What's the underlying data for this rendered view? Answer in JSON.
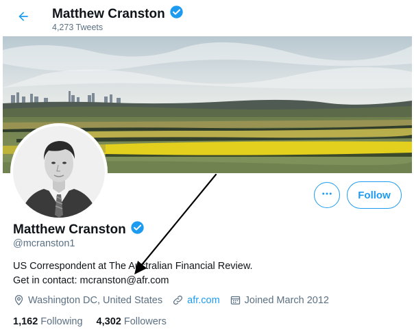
{
  "header": {
    "title": "Matthew Cranston",
    "tweet_count": "4,273 Tweets"
  },
  "profile": {
    "name": "Matthew Cranston",
    "handle": "@mcranston1",
    "bio_line1": "US Correspondent at The Australian Financial Review.",
    "bio_line2": "Get in contact: mcranston@afr.com",
    "location": "Washington DC, United States",
    "website": "afr.com",
    "joined": "Joined March 2012",
    "following_count": "1,162",
    "following_label": "Following",
    "followers_count": "4,302",
    "followers_label": "Followers"
  },
  "actions": {
    "follow_label": "Follow"
  },
  "icons": {
    "back": "arrow-left-icon",
    "verified": "verified-badge-icon",
    "more": "more-dots-icon",
    "location": "location-pin-icon",
    "link": "link-icon",
    "calendar": "calendar-icon"
  },
  "colors": {
    "accent": "#1d9bf0",
    "text": "#0f1419",
    "muted": "#5b7083"
  }
}
